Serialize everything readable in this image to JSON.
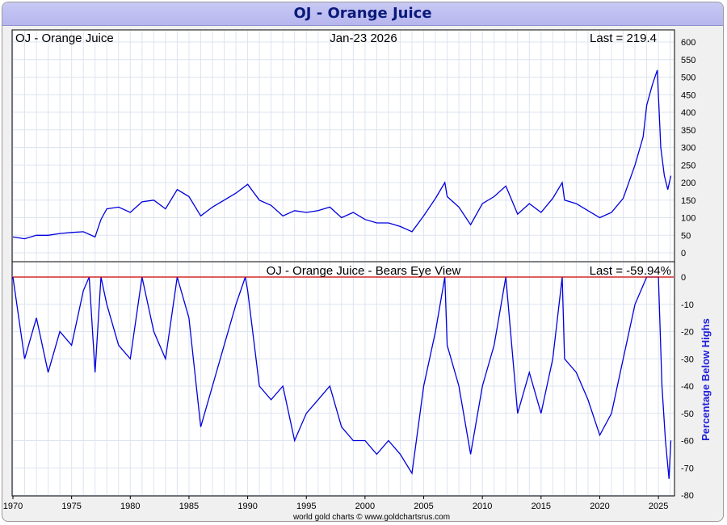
{
  "window": {
    "title": "OJ  -  Orange Juice"
  },
  "footer": {
    "credit": "world gold charts © www.goldchartsrus.com"
  },
  "chart_data": [
    {
      "type": "line",
      "title": "OJ  -  Orange Juice",
      "date_label": "Jan-23  2026",
      "last_label": "Last = 219.4",
      "ylim": [
        -20,
        620
      ],
      "y_ticks": [
        0,
        50,
        100,
        150,
        200,
        250,
        300,
        350,
        400,
        450,
        500,
        550,
        600
      ],
      "grid": true,
      "color": "#0000dd",
      "series": [
        {
          "x": [
            1970,
            1971,
            1972,
            1973,
            1974,
            1975,
            1976,
            1977,
            1977.5,
            1978,
            1979,
            1980,
            1981,
            1982,
            1983,
            1984,
            1985,
            1986,
            1987,
            1988,
            1989,
            1990,
            1991,
            1992,
            1993,
            1994,
            1995,
            1996,
            1997,
            1998,
            1999,
            2000,
            2001,
            2002,
            2003,
            2004,
            2005,
            2006,
            2006.8,
            2007,
            2008,
            2009,
            2010,
            2011,
            2012,
            2013,
            2014,
            2015,
            2016,
            2016.8,
            2017,
            2018,
            2019,
            2020,
            2021,
            2022,
            2023,
            2023.7,
            2024,
            2024.5,
            2024.9,
            2025.2,
            2025.5,
            2025.8,
            2026.06
          ],
          "y": [
            45,
            40,
            50,
            50,
            55,
            58,
            60,
            45,
            95,
            125,
            130,
            115,
            145,
            150,
            125,
            180,
            160,
            105,
            130,
            150,
            170,
            195,
            150,
            135,
            105,
            120,
            115,
            120,
            130,
            100,
            115,
            95,
            85,
            85,
            75,
            60,
            105,
            155,
            200,
            160,
            130,
            80,
            140,
            160,
            190,
            110,
            140,
            115,
            155,
            200,
            150,
            140,
            120,
            100,
            115,
            155,
            250,
            330,
            420,
            480,
            520,
            300,
            220,
            180,
            219.4
          ]
        }
      ]
    },
    {
      "type": "line",
      "title": "OJ  -  Orange Juice - Bears Eye View",
      "last_label": "Last = -59.94%",
      "ylabel": "Percentage Below Highs",
      "ylim": [
        -80,
        0
      ],
      "y_ticks": [
        0,
        -10,
        -20,
        -30,
        -40,
        -50,
        -60,
        -70,
        -80
      ],
      "x_ticks": [
        1970,
        1975,
        1980,
        1985,
        1990,
        1995,
        2000,
        2005,
        2010,
        2015,
        2020,
        2025
      ],
      "grid": true,
      "color": "#0000dd",
      "baseline_color": "#cc0000",
      "series": [
        {
          "x": [
            1970,
            1971,
            1972,
            1973,
            1974,
            1975,
            1976,
            1976.5,
            1977,
            1977.5,
            1978,
            1979,
            1980,
            1981,
            1982,
            1983,
            1984,
            1985,
            1986,
            1987,
            1988,
            1989,
            1989.8,
            1990,
            1991,
            1992,
            1993,
            1994,
            1995,
            1996,
            1997,
            1998,
            1999,
            2000,
            2001,
            2002,
            2003,
            2004,
            2005,
            2006,
            2006.8,
            2007,
            2008,
            2009,
            2010,
            2011,
            2012,
            2013,
            2014,
            2015,
            2016,
            2016.8,
            2017,
            2018,
            2019,
            2020,
            2021,
            2022,
            2023,
            2024,
            2025,
            2025.3,
            2025.6,
            2025.9,
            2026.06
          ],
          "y": [
            0,
            -30,
            -15,
            -35,
            -20,
            -25,
            -5,
            0,
            -35,
            0,
            -10,
            -25,
            -30,
            0,
            -20,
            -30,
            0,
            -15,
            -55,
            -40,
            -25,
            -10,
            0,
            -5,
            -40,
            -45,
            -40,
            -60,
            -50,
            -45,
            -40,
            -55,
            -60,
            -60,
            -65,
            -60,
            -65,
            -72,
            -40,
            -20,
            0,
            -25,
            -40,
            -65,
            -40,
            -25,
            0,
            -50,
            -35,
            -50,
            -30,
            0,
            -30,
            -35,
            -45,
            -58,
            -50,
            -30,
            -10,
            0,
            0,
            -40,
            -60,
            -74,
            -59.94
          ]
        }
      ]
    }
  ]
}
